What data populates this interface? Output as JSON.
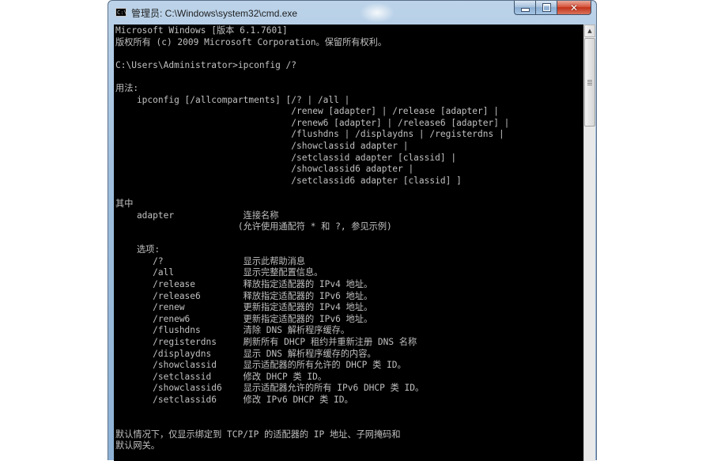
{
  "window": {
    "title": "管理员: C:\\Windows\\system32\\cmd.exe",
    "icon_label": "C:\\"
  },
  "caption_buttons": {
    "minimize": "minimize-icon",
    "maximize": "maximize-icon",
    "close": "close-icon"
  },
  "console": {
    "lines": [
      "Microsoft Windows [版本 6.1.7601]",
      "版权所有 (c) 2009 Microsoft Corporation。保留所有权利。",
      "",
      "C:\\Users\\Administrator>ipconfig /?",
      "",
      "用法:",
      "    ipconfig [/allcompartments] [/? | /all |",
      "                                 /renew [adapter] | /release [adapter] |",
      "                                 /renew6 [adapter] | /release6 [adapter] |",
      "                                 /flushdns | /displaydns | /registerdns |",
      "                                 /showclassid adapter |",
      "                                 /setclassid adapter [classid] |",
      "                                 /showclassid6 adapter |",
      "                                 /setclassid6 adapter [classid] ]",
      "",
      "其中",
      "    adapter             连接名称",
      "                       (允许使用通配符 * 和 ?, 参见示例)",
      "",
      "    选项:",
      "       /?               显示此帮助消息",
      "       /all             显示完整配置信息。",
      "       /release         释放指定适配器的 IPv4 地址。",
      "       /release6        释放指定适配器的 IPv6 地址。",
      "       /renew           更新指定适配器的 IPv4 地址。",
      "       /renew6          更新指定适配器的 IPv6 地址。",
      "       /flushdns        清除 DNS 解析程序缓存。",
      "       /registerdns     刷新所有 DHCP 租约并重新注册 DNS 名称",
      "       /displaydns      显示 DNS 解析程序缓存的内容。",
      "       /showclassid     显示适配器的所有允许的 DHCP 类 ID。",
      "       /setclassid      修改 DHCP 类 ID。",
      "       /showclassid6    显示适配器允许的所有 IPv6 DHCP 类 ID。",
      "       /setclassid6     修改 IPv6 DHCP 类 ID。",
      "",
      "",
      "默认情况下，仅显示绑定到 TCP/IP 的适配器的 IP 地址、子网掩码和",
      "默认网关。"
    ]
  },
  "colors": {
    "console_background": "#000000",
    "console_text": "#c0c0c0",
    "close_button": "#c2321a"
  }
}
